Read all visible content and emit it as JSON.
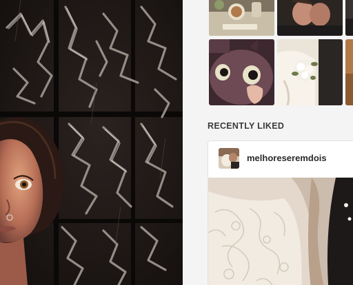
{
  "recently_liked": {
    "heading": "RECENTLY LIKED",
    "post": {
      "username": "melhoreseremdois"
    }
  },
  "icons": {
    "artwork": "illustrated-portrait-artwork",
    "thumbnails": [
      "cozy-drinks-photo",
      "couple-kiss-photo",
      "partial-photo",
      "monster-character-photo",
      "bride-bouquet-photo",
      "partial-photo"
    ],
    "avatar": "couple-avatar-photo",
    "post_image": "lace-wedding-dress-photo"
  },
  "colors": {
    "page_background": "#f4f4f4",
    "heading_text": "#3a3a3a",
    "username_text": "#2b2b2b",
    "card_border": "#e2e2e2"
  }
}
